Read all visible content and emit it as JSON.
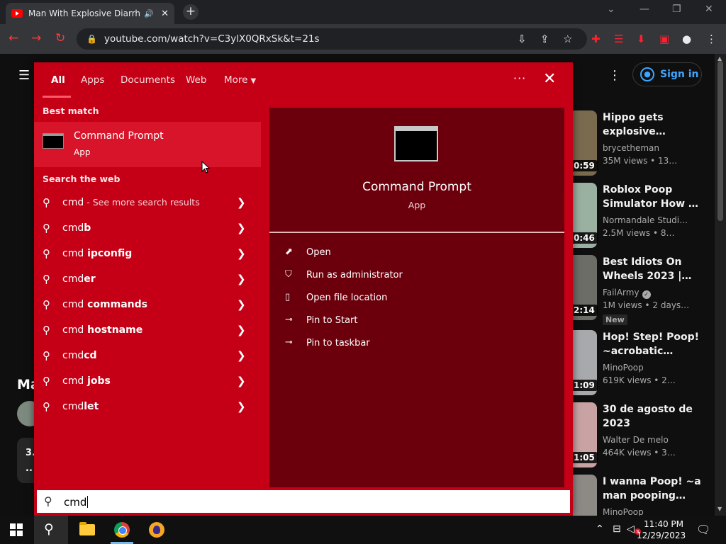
{
  "browser": {
    "tab_title": "Man With Explosive Diarrhea",
    "url": "youtube.com/watch?v=C3ylX0QRxSk&t=21s"
  },
  "youtube": {
    "sign_in_label": "Sign in",
    "left_fragment_title": "Ma",
    "left_fragment_card": "3.",
    "left_fragment_card2": "..",
    "videos": [
      {
        "title": "Hippo gets explosive…",
        "channel": "brycetheman",
        "meta": "35M views • 13…",
        "duration": "0:59",
        "thumb_color": "#7a6a4e",
        "verified": false,
        "new_badge": ""
      },
      {
        "title": "Roblox Poop Simulator How …",
        "channel": "Normandale Studi…",
        "meta": "2.5M views • 8…",
        "duration": "0:46",
        "thumb_color": "#9ab0a0",
        "verified": false,
        "new_badge": ""
      },
      {
        "title": "Best Idiots On Wheels 2023 |…",
        "channel": "FailArmy",
        "meta": "1M views • 2 days…",
        "duration": "2:14",
        "thumb_color": "#6d6d68",
        "verified": true,
        "new_badge": "New"
      },
      {
        "title": "Hop! Step! Poop! ~acrobatic…",
        "channel": "MinoPoop",
        "meta": "619K views • 2…",
        "duration": "1:09",
        "thumb_color": "#a7a9ad",
        "verified": false,
        "new_badge": ""
      },
      {
        "title": "30 de agosto de 2023",
        "channel": "Walter De melo",
        "meta": "464K views • 3…",
        "duration": "1:05",
        "thumb_color": "#c9a3a3",
        "verified": false,
        "new_badge": ""
      },
      {
        "title": "I wanna Poop! ~a man pooping…",
        "channel": "MinoPoop",
        "meta": "",
        "duration": "",
        "thumb_color": "#8d8a86",
        "verified": false,
        "new_badge": ""
      }
    ]
  },
  "search": {
    "tabs": [
      {
        "label": "All",
        "active": true
      },
      {
        "label": "Apps",
        "active": false
      },
      {
        "label": "Documents",
        "active": false
      },
      {
        "label": "Web",
        "active": false
      },
      {
        "label": "More",
        "active": false
      }
    ],
    "best_match_label": "Best match",
    "best_match": {
      "title": "Command Prompt",
      "subtitle": "App"
    },
    "web_label": "Search the web",
    "web_results": [
      {
        "prefix": "cmd",
        "bold": "",
        "suffix": " - See more search results"
      },
      {
        "prefix": "cmd",
        "bold": "b",
        "suffix": ""
      },
      {
        "prefix": "cmd",
        "bold": " ipconfig",
        "suffix": ""
      },
      {
        "prefix": "cmd",
        "bold": "er",
        "suffix": ""
      },
      {
        "prefix": "cmd",
        "bold": " commands",
        "suffix": ""
      },
      {
        "prefix": "cmd",
        "bold": " hostname",
        "suffix": ""
      },
      {
        "prefix": "cmd",
        "bold": "cd",
        "suffix": ""
      },
      {
        "prefix": "cmd",
        "bold": " jobs",
        "suffix": ""
      },
      {
        "prefix": "cmd",
        "bold": "let",
        "suffix": ""
      }
    ],
    "detail": {
      "title": "Command Prompt",
      "subtitle": "App",
      "actions": [
        {
          "label": "Open",
          "icon": "open-icon"
        },
        {
          "label": "Run as administrator",
          "icon": "shield-icon"
        },
        {
          "label": "Open file location",
          "icon": "file-icon"
        },
        {
          "label": "Pin to Start",
          "icon": "pin-icon"
        },
        {
          "label": "Pin to taskbar",
          "icon": "pin-icon"
        }
      ]
    },
    "query": "cmd"
  },
  "taskbar": {
    "time": "11:40 PM",
    "date": "12/29/2023"
  },
  "colors": {
    "search_bg": "#c50016",
    "search_detail_bg": "#6b000c",
    "best_match_bg": "#d8142a",
    "yt_accent": "#3ea6ff"
  }
}
